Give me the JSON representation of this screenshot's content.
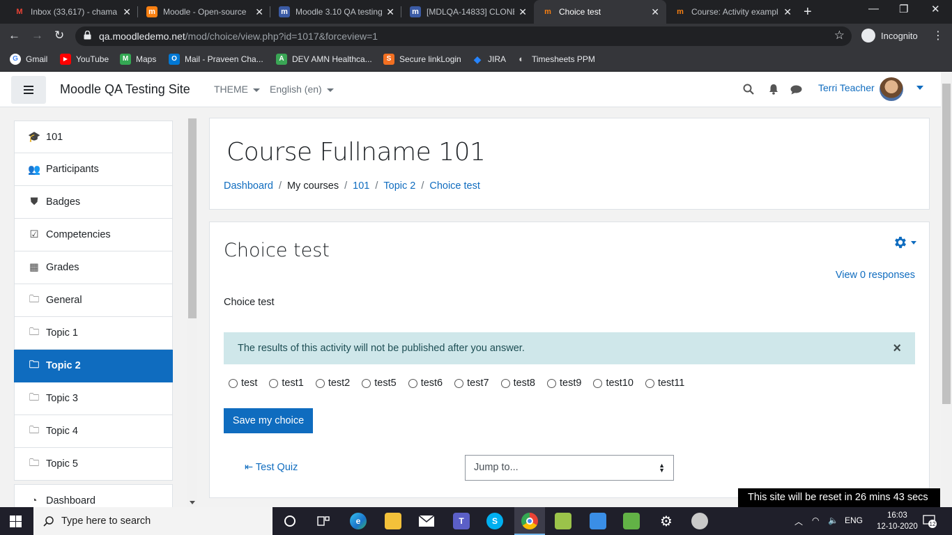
{
  "browser": {
    "tabs": [
      {
        "title": "Inbox (33,617) - chama",
        "favicon": "gmail-icon",
        "color": "#ea4335"
      },
      {
        "title": "Moodle - Open-source",
        "favicon": "moodle-icon",
        "color": "#f98012"
      },
      {
        "title": "Moodle 3.10 QA testing",
        "favicon": "moodle-m-icon",
        "color": "#3b5ba5"
      },
      {
        "title": "[MDLQA-14833] CLONE",
        "favicon": "moodle-m-icon",
        "color": "#3b5ba5"
      },
      {
        "title": "Choice test",
        "favicon": "moodle-icon",
        "color": "#f98012"
      },
      {
        "title": "Course: Activity exampl",
        "favicon": "moodle-icon",
        "color": "#f98012"
      }
    ],
    "url_host": "qa.moodledemo.net",
    "url_path": "/mod/choice/view.php?id=1017&forceview=1",
    "incognito_label": "Incognito",
    "bookmarks": [
      {
        "label": "Gmail",
        "color": "#ea4335",
        "glyph": "G"
      },
      {
        "label": "YouTube",
        "color": "#ff0000",
        "glyph": "▶"
      },
      {
        "label": "Maps",
        "color": "#34a853",
        "glyph": "M"
      },
      {
        "label": "Mail - Praveen Cha...",
        "color": "#0078d4",
        "glyph": "O"
      },
      {
        "label": "DEV AMN Healthca...",
        "color": "#3aa655",
        "glyph": "A"
      },
      {
        "label": "Secure linkLogin",
        "color": "#f26f21",
        "glyph": "S"
      },
      {
        "label": "JIRA",
        "color": "#2684ff",
        "glyph": "◆"
      },
      {
        "label": "Timesheets PPM",
        "color": "#555555",
        "glyph": "◐"
      }
    ]
  },
  "navbar": {
    "site_name": "Moodle QA Testing Site",
    "theme_label": "THEME",
    "language_label": "English (en)",
    "user_name": "Terri Teacher"
  },
  "drawer": {
    "items": [
      {
        "label": "101",
        "icon": "graduation-cap-icon",
        "glyph": "🎓",
        "active": false
      },
      {
        "label": "Participants",
        "icon": "users-icon",
        "glyph": "👥",
        "active": false
      },
      {
        "label": "Badges",
        "icon": "shield-icon",
        "glyph": "⛊",
        "active": false
      },
      {
        "label": "Competencies",
        "icon": "checkbox-icon",
        "glyph": "☑",
        "active": false
      },
      {
        "label": "Grades",
        "icon": "table-icon",
        "glyph": "▦",
        "active": false
      },
      {
        "label": "General",
        "icon": "folder-icon",
        "glyph": "🗀",
        "active": false
      },
      {
        "label": "Topic 1",
        "icon": "folder-icon",
        "glyph": "🗀",
        "active": false
      },
      {
        "label": "Topic 2",
        "icon": "folder-icon",
        "glyph": "🗀",
        "active": true
      },
      {
        "label": "Topic 3",
        "icon": "folder-icon",
        "glyph": "🗀",
        "active": false
      },
      {
        "label": "Topic 4",
        "icon": "folder-icon",
        "glyph": "🗀",
        "active": false
      },
      {
        "label": "Topic 5",
        "icon": "folder-icon",
        "glyph": "🗀",
        "active": false
      }
    ],
    "dashboard_label": "Dashboard"
  },
  "header": {
    "course_title": "Course Fullname 101",
    "breadcrumb": [
      {
        "label": "Dashboard",
        "link": true
      },
      {
        "label": "My courses",
        "link": false
      },
      {
        "label": "101",
        "link": true
      },
      {
        "label": "Topic 2",
        "link": true
      },
      {
        "label": "Choice test",
        "link": true
      }
    ]
  },
  "activity": {
    "title": "Choice test",
    "view_responses": "View 0 responses",
    "intro": "Choice test",
    "alert": "The results of this activity will not be published after you answer.",
    "options": [
      "test",
      "test1",
      "test2",
      "test5",
      "test6",
      "test7",
      "test8",
      "test9",
      "test10",
      "test11"
    ],
    "save_label": "Save my choice",
    "prev_link": "Test Quiz",
    "jump_label": "Jump to..."
  },
  "reset_notice": "This site will be reset in 26 mins 43 secs",
  "taskbar": {
    "search_placeholder": "Type here to search",
    "language": "ENG",
    "time": "16:03",
    "date": "12-10-2020",
    "notification_count": "12"
  }
}
